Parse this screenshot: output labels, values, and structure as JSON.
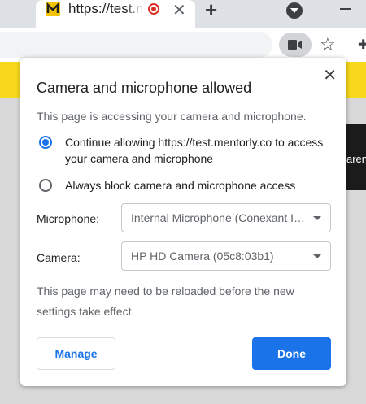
{
  "browser": {
    "tab_title": "https://test.mentorly.co",
    "new_tab_label": "+",
    "tab_close_label": "✕"
  },
  "page": {
    "partial_text": "aren"
  },
  "dialog": {
    "title": "Camera and microphone allowed",
    "subtitle": "This page is accessing your camera and microphone.",
    "close_label": "✕",
    "options": [
      {
        "label": "Continue allowing https://test.mentorly.co to access your camera and microphone",
        "selected": true
      },
      {
        "label": "Always block camera and microphone access",
        "selected": false
      }
    ],
    "microphone_label": "Microphone:",
    "microphone_value": "Internal Microphone (Conexant ISST Audio)",
    "camera_label": "Camera:",
    "camera_value": "HP HD Camera (05c8:03b1)",
    "note": "This page may need to be reloaded before the new settings take effect.",
    "manage_label": "Manage",
    "done_label": "Done"
  },
  "colors": {
    "accent": "#1a73e8",
    "page_banner": "#f8d81c",
    "recording": "#d93025"
  },
  "icons": [
    "mentorly-favicon",
    "recording-icon",
    "close-icon",
    "new-tab-icon",
    "tab-search-icon",
    "minimize-icon",
    "camera-icon",
    "star-icon",
    "extensions-icon",
    "chevron-down-icon"
  ]
}
